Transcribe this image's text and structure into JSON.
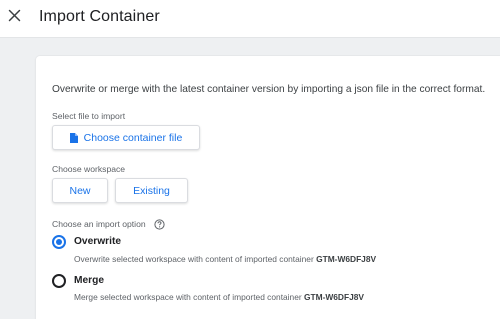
{
  "header": {
    "close_icon": "close-icon",
    "title": "Import Container"
  },
  "main": {
    "description": "Overwrite or merge with the latest container version by importing a json file in the correct format.",
    "select_file_label": "Select file to import",
    "choose_file_button": "Choose container file",
    "choose_file_icon": "file-icon",
    "workspace_label": "Choose workspace",
    "workspace_buttons": {
      "new": "New",
      "existing": "Existing"
    },
    "import_option_label": "Choose an import option",
    "help_icon": "help-circle-icon",
    "options": [
      {
        "title": "Overwrite",
        "description": "Overwrite selected workspace with content of imported container",
        "container_id": "GTM-W6DFJ8V",
        "selected": true
      },
      {
        "title": "Merge",
        "description": "Merge selected workspace with content of imported container",
        "container_id": "GTM-W6DFJ8V",
        "selected": false
      }
    ]
  },
  "colors": {
    "accent": "#1a73e8",
    "background": "#eef0f2",
    "card": "#ffffff",
    "text": "#202124",
    "muted": "#5f6368"
  }
}
